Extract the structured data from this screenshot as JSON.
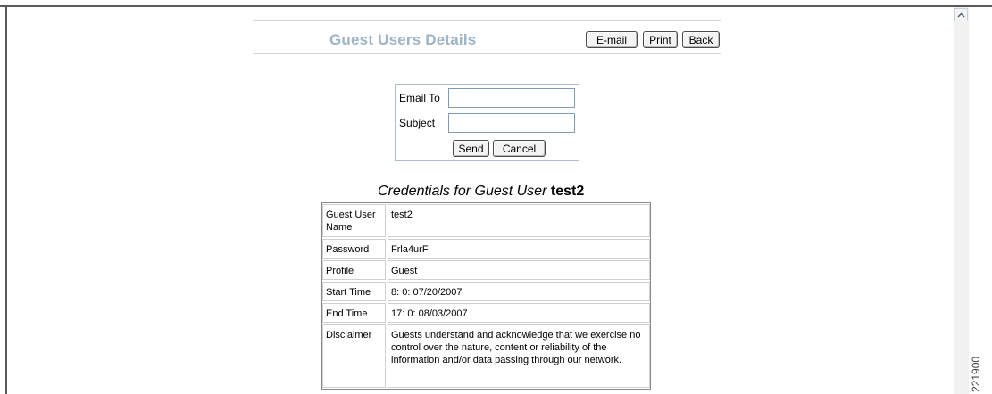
{
  "header": {
    "title": "Guest Users Details",
    "email_label": "E-mail",
    "print_label": "Print",
    "back_label": "Back"
  },
  "email_form": {
    "email_to_label": "Email To",
    "email_to_value": "",
    "subject_label": "Subject",
    "subject_value": "",
    "send_label": "Send",
    "cancel_label": "Cancel"
  },
  "credentials": {
    "title_prefix": "Credentials for Guest User",
    "username": "test2",
    "rows": [
      {
        "label": "Guest User Name",
        "value": "test2"
      },
      {
        "label": "Password",
        "value": "Frla4urF"
      },
      {
        "label": "Profile",
        "value": "Guest"
      },
      {
        "label": "Start Time",
        "value": "8: 0: 07/20/2007"
      },
      {
        "label": "End Time",
        "value": "17: 0: 08/03/2007"
      },
      {
        "label": "Disclaimer",
        "value": "Guests understand and acknowledge that we exercise no control over the nature, content or reliability of the information and/or data passing through our network."
      }
    ]
  },
  "figure_id": "221900",
  "icons": {
    "scroll_up": "chevron-up-icon"
  },
  "colors": {
    "title": "#9eb3c8",
    "form_border": "#a8bdd3"
  }
}
